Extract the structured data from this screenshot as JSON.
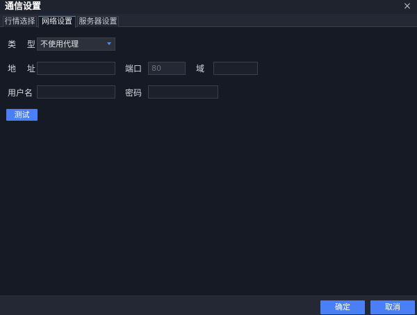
{
  "window": {
    "title": "通信设置",
    "close": "×"
  },
  "tabs": [
    {
      "label": "行情选择"
    },
    {
      "label": "网络设置"
    },
    {
      "label": "服务器设置"
    }
  ],
  "form": {
    "type_label": "类 型",
    "type_value": "不使用代理",
    "address_label": "地 址",
    "address_value": "",
    "port_label": "端口",
    "port_value": "80",
    "domain_label": "域",
    "domain_value": "",
    "username_label": "用户名",
    "username_value": "",
    "password_label": "密码",
    "password_value": "",
    "test_button": "测试"
  },
  "footer": {
    "ok_button": "确定",
    "cancel_button": "取消"
  },
  "colors": {
    "accent": "#4a7ff5",
    "background": "#161a25"
  }
}
